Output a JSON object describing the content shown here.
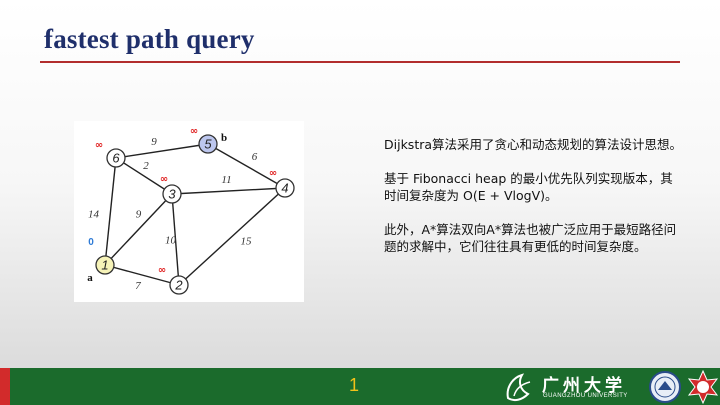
{
  "slide": {
    "title": "fastest path query"
  },
  "graph": {
    "nodes": [
      {
        "id": "1",
        "label": "1",
        "dist": "0",
        "tag": "a"
      },
      {
        "id": "2",
        "label": "2",
        "dist": "∞",
        "tag": ""
      },
      {
        "id": "3",
        "label": "3",
        "dist": "∞",
        "tag": ""
      },
      {
        "id": "4",
        "label": "4",
        "dist": "∞",
        "tag": ""
      },
      {
        "id": "5",
        "label": "5",
        "dist": "∞",
        "tag": "b"
      },
      {
        "id": "6",
        "label": "6",
        "dist": "∞",
        "tag": ""
      }
    ],
    "edges": [
      {
        "from": "6",
        "to": "5",
        "weight": "9"
      },
      {
        "from": "5",
        "to": "4",
        "weight": "6"
      },
      {
        "from": "6",
        "to": "3",
        "weight": "2"
      },
      {
        "from": "3",
        "to": "4",
        "weight": "11"
      },
      {
        "from": "6",
        "to": "1",
        "weight": "14"
      },
      {
        "from": "1",
        "to": "3",
        "weight": "9"
      },
      {
        "from": "3",
        "to": "2",
        "weight": "10"
      },
      {
        "from": "2",
        "to": "4",
        "weight": "15"
      },
      {
        "from": "1",
        "to": "2",
        "weight": "7"
      }
    ],
    "colors": {
      "start_node_fill": "#f6f3b8",
      "target_node_fill": "#bcc6ee",
      "node_fill": "#ffffff",
      "infinity_color": "#e02020",
      "zero_color": "#2f7bd6"
    }
  },
  "text": {
    "para1": "Dijkstra算法采用了贪心和动态规划的算法设计思想。",
    "para2": "基于 Fibonacci heap 的最小优先队列实现版本，其时间复杂度为 O(E + VlogV)。",
    "para3": "此外，A*算法双向A*算法也被广泛应用于最短路径问题的求解中，它们往往具有更低的时间复杂度。"
  },
  "footer": {
    "page_number": "1",
    "university_cn": "广州大学",
    "university_en": "GUANGZHOU UNIVERSITY",
    "bar_color": "#1b6b2c",
    "accent_color": "#d22b2b"
  }
}
